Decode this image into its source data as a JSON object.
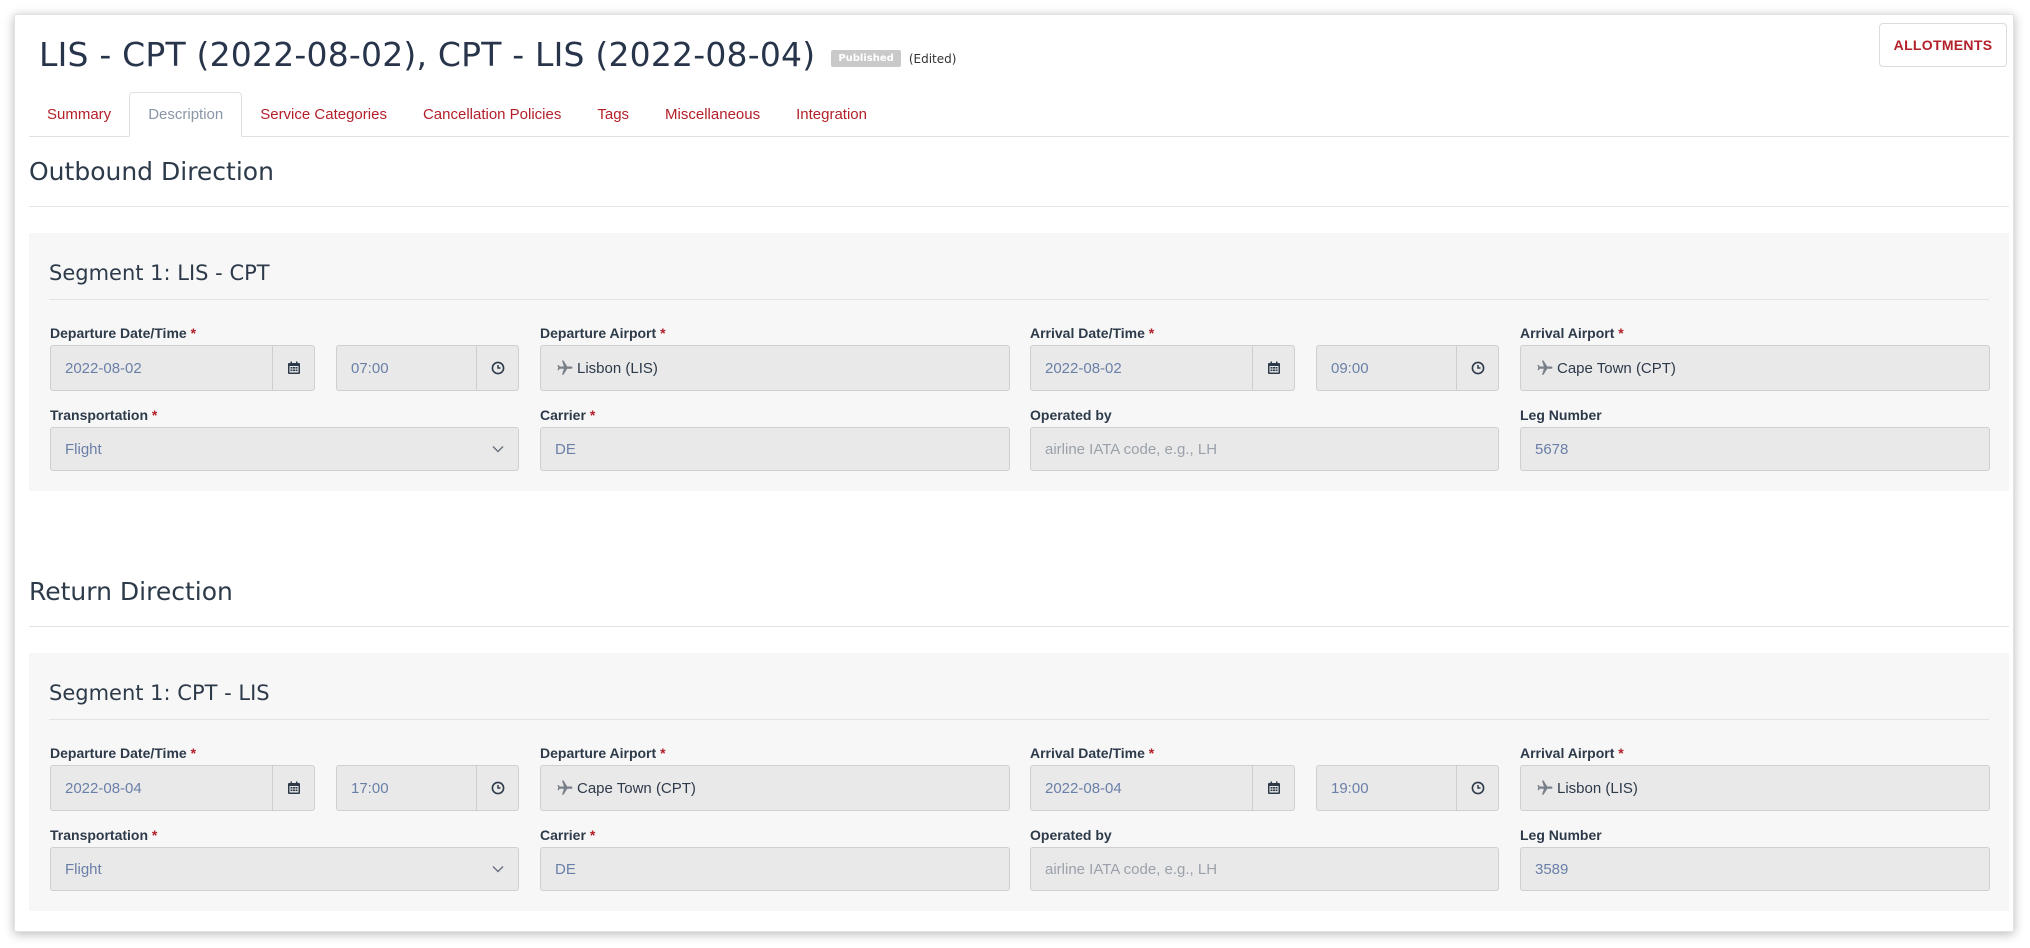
{
  "header": {
    "title": "LIS - CPT (2022-08-02), CPT - LIS (2022-08-04)",
    "badge": "Published",
    "edited": "(Edited)",
    "allotments_label": "ALLOTMENTS"
  },
  "tabs": [
    {
      "label": "Summary"
    },
    {
      "label": "Description",
      "active": true
    },
    {
      "label": "Service Categories"
    },
    {
      "label": "Cancellation Policies"
    },
    {
      "label": "Tags"
    },
    {
      "label": "Miscellaneous"
    },
    {
      "label": "Integration"
    }
  ],
  "labels": {
    "departure_datetime": "Departure Date/Time",
    "departure_airport": "Departure Airport",
    "arrival_datetime": "Arrival Date/Time",
    "arrival_airport": "Arrival Airport",
    "transportation": "Transportation",
    "carrier": "Carrier",
    "operated_by": "Operated by",
    "leg_number": "Leg Number",
    "required_mark": "*",
    "operated_by_placeholder": "airline IATA code, e.g., LH"
  },
  "outbound": {
    "title": "Outbound Direction",
    "segment_title": "Segment 1: LIS - CPT",
    "departure_date": "2022-08-02",
    "departure_time": "07:00",
    "departure_airport": "Lisbon (LIS)",
    "arrival_date": "2022-08-02",
    "arrival_time": "09:00",
    "arrival_airport": "Cape Town (CPT)",
    "transportation": "Flight",
    "carrier": "DE",
    "operated_by": "",
    "leg_number": "5678"
  },
  "return": {
    "title": "Return Direction",
    "segment_title": "Segment 1: CPT - LIS",
    "departure_date": "2022-08-04",
    "departure_time": "17:00",
    "departure_airport": "Cape Town (CPT)",
    "arrival_date": "2022-08-04",
    "arrival_time": "19:00",
    "arrival_airport": "Lisbon (LIS)",
    "transportation": "Flight",
    "carrier": "DE",
    "operated_by": "",
    "leg_number": "3589"
  },
  "colors": {
    "accent": "#b3202a",
    "text": "#2d3a4a",
    "input_bg": "#e9e9e9",
    "input_text": "#6a7fa8"
  }
}
